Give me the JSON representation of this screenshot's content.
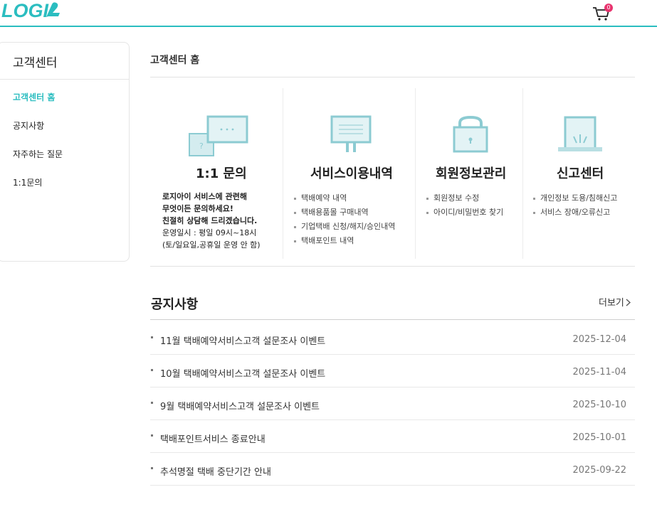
{
  "header": {
    "logo": "LOGI",
    "cart_count": "0"
  },
  "sidebar": {
    "title": "고객센터",
    "items": [
      {
        "label": "고객센터 홈",
        "active": true
      },
      {
        "label": "공지사항"
      },
      {
        "label": "자주하는 질문"
      },
      {
        "label": "1:1문의"
      }
    ]
  },
  "main": {
    "title": "고객센터 홈",
    "services": [
      {
        "title": "1:1 문의",
        "icon": "chat-bubbles-icon",
        "desc_bold": [
          "로지아이 서비스에 관련해",
          "무엇이든 문의하세요!",
          "친절히 상담해 드리겠습니다."
        ],
        "desc": [
          "운영일시 : 평일 09시~18시",
          "(토/일요일,공휴일 운영 안 함)"
        ]
      },
      {
        "title": "서비스이용내역",
        "icon": "monitor-icon",
        "items": [
          "택배예약 내역",
          "택배용품몰 구매내역",
          "기업택배 신청/해지/승인내역",
          "택배포인트 내역"
        ]
      },
      {
        "title": "회원정보관리",
        "icon": "lock-icon",
        "items": [
          "회원정보 수정",
          "아이디/비밀번호 찾기"
        ]
      },
      {
        "title": "신고센터",
        "icon": "alert-siren-icon",
        "items": [
          "개인정보 도용/침해신고",
          "서비스 장애/오류신고"
        ]
      }
    ]
  },
  "notice": {
    "title": "공지사항",
    "more": "더보기",
    "rows": [
      {
        "text": "11월 택배예약서비스고객 설문조사 이벤트",
        "date": "2025-12-04"
      },
      {
        "text": "10월 택배예약서비스고객 설문조사 이벤트",
        "date": "2025-11-04"
      },
      {
        "text": "9월 택배예약서비스고객 설문조사 이벤트",
        "date": "2025-10-10"
      },
      {
        "text": "택배포인트서비스 종료안내",
        "date": "2025-10-01"
      },
      {
        "text": "추석명절 택배 중단기간 안내",
        "date": "2025-09-22"
      }
    ]
  },
  "colors": {
    "accent": "#2bbdc0",
    "icon_light": "#b9dfe3",
    "icon_dark": "#7cc4cc",
    "badge": "#e8336e"
  }
}
